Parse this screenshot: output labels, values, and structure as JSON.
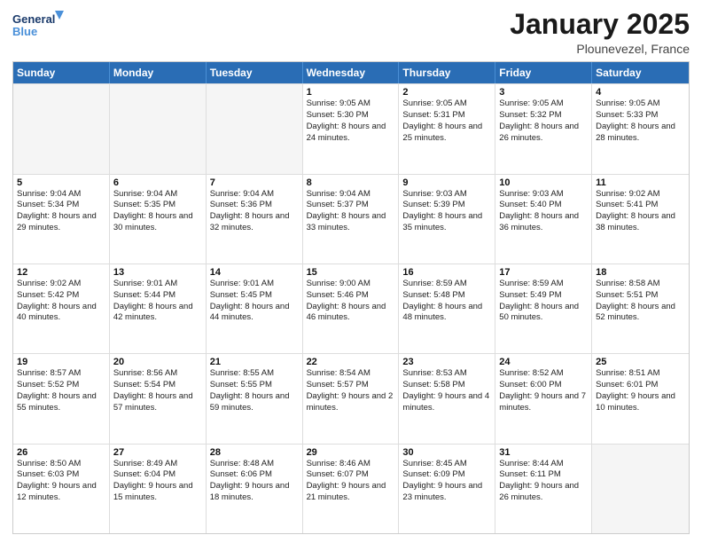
{
  "header": {
    "logo_line1": "General",
    "logo_line2": "Blue",
    "month_title": "January 2025",
    "location": "Plounevezel, France"
  },
  "weekdays": [
    "Sunday",
    "Monday",
    "Tuesday",
    "Wednesday",
    "Thursday",
    "Friday",
    "Saturday"
  ],
  "weeks": [
    [
      {
        "day": "",
        "sunrise": "",
        "sunset": "",
        "daylight": "",
        "empty": true
      },
      {
        "day": "",
        "sunrise": "",
        "sunset": "",
        "daylight": "",
        "empty": true
      },
      {
        "day": "",
        "sunrise": "",
        "sunset": "",
        "daylight": "",
        "empty": true
      },
      {
        "day": "1",
        "sunrise": "Sunrise: 9:05 AM",
        "sunset": "Sunset: 5:30 PM",
        "daylight": "Daylight: 8 hours and 24 minutes."
      },
      {
        "day": "2",
        "sunrise": "Sunrise: 9:05 AM",
        "sunset": "Sunset: 5:31 PM",
        "daylight": "Daylight: 8 hours and 25 minutes."
      },
      {
        "day": "3",
        "sunrise": "Sunrise: 9:05 AM",
        "sunset": "Sunset: 5:32 PM",
        "daylight": "Daylight: 8 hours and 26 minutes."
      },
      {
        "day": "4",
        "sunrise": "Sunrise: 9:05 AM",
        "sunset": "Sunset: 5:33 PM",
        "daylight": "Daylight: 8 hours and 28 minutes."
      }
    ],
    [
      {
        "day": "5",
        "sunrise": "Sunrise: 9:04 AM",
        "sunset": "Sunset: 5:34 PM",
        "daylight": "Daylight: 8 hours and 29 minutes."
      },
      {
        "day": "6",
        "sunrise": "Sunrise: 9:04 AM",
        "sunset": "Sunset: 5:35 PM",
        "daylight": "Daylight: 8 hours and 30 minutes."
      },
      {
        "day": "7",
        "sunrise": "Sunrise: 9:04 AM",
        "sunset": "Sunset: 5:36 PM",
        "daylight": "Daylight: 8 hours and 32 minutes."
      },
      {
        "day": "8",
        "sunrise": "Sunrise: 9:04 AM",
        "sunset": "Sunset: 5:37 PM",
        "daylight": "Daylight: 8 hours and 33 minutes."
      },
      {
        "day": "9",
        "sunrise": "Sunrise: 9:03 AM",
        "sunset": "Sunset: 5:39 PM",
        "daylight": "Daylight: 8 hours and 35 minutes."
      },
      {
        "day": "10",
        "sunrise": "Sunrise: 9:03 AM",
        "sunset": "Sunset: 5:40 PM",
        "daylight": "Daylight: 8 hours and 36 minutes."
      },
      {
        "day": "11",
        "sunrise": "Sunrise: 9:02 AM",
        "sunset": "Sunset: 5:41 PM",
        "daylight": "Daylight: 8 hours and 38 minutes."
      }
    ],
    [
      {
        "day": "12",
        "sunrise": "Sunrise: 9:02 AM",
        "sunset": "Sunset: 5:42 PM",
        "daylight": "Daylight: 8 hours and 40 minutes."
      },
      {
        "day": "13",
        "sunrise": "Sunrise: 9:01 AM",
        "sunset": "Sunset: 5:44 PM",
        "daylight": "Daylight: 8 hours and 42 minutes."
      },
      {
        "day": "14",
        "sunrise": "Sunrise: 9:01 AM",
        "sunset": "Sunset: 5:45 PM",
        "daylight": "Daylight: 8 hours and 44 minutes."
      },
      {
        "day": "15",
        "sunrise": "Sunrise: 9:00 AM",
        "sunset": "Sunset: 5:46 PM",
        "daylight": "Daylight: 8 hours and 46 minutes."
      },
      {
        "day": "16",
        "sunrise": "Sunrise: 8:59 AM",
        "sunset": "Sunset: 5:48 PM",
        "daylight": "Daylight: 8 hours and 48 minutes."
      },
      {
        "day": "17",
        "sunrise": "Sunrise: 8:59 AM",
        "sunset": "Sunset: 5:49 PM",
        "daylight": "Daylight: 8 hours and 50 minutes."
      },
      {
        "day": "18",
        "sunrise": "Sunrise: 8:58 AM",
        "sunset": "Sunset: 5:51 PM",
        "daylight": "Daylight: 8 hours and 52 minutes."
      }
    ],
    [
      {
        "day": "19",
        "sunrise": "Sunrise: 8:57 AM",
        "sunset": "Sunset: 5:52 PM",
        "daylight": "Daylight: 8 hours and 55 minutes."
      },
      {
        "day": "20",
        "sunrise": "Sunrise: 8:56 AM",
        "sunset": "Sunset: 5:54 PM",
        "daylight": "Daylight: 8 hours and 57 minutes."
      },
      {
        "day": "21",
        "sunrise": "Sunrise: 8:55 AM",
        "sunset": "Sunset: 5:55 PM",
        "daylight": "Daylight: 8 hours and 59 minutes."
      },
      {
        "day": "22",
        "sunrise": "Sunrise: 8:54 AM",
        "sunset": "Sunset: 5:57 PM",
        "daylight": "Daylight: 9 hours and 2 minutes."
      },
      {
        "day": "23",
        "sunrise": "Sunrise: 8:53 AM",
        "sunset": "Sunset: 5:58 PM",
        "daylight": "Daylight: 9 hours and 4 minutes."
      },
      {
        "day": "24",
        "sunrise": "Sunrise: 8:52 AM",
        "sunset": "Sunset: 6:00 PM",
        "daylight": "Daylight: 9 hours and 7 minutes."
      },
      {
        "day": "25",
        "sunrise": "Sunrise: 8:51 AM",
        "sunset": "Sunset: 6:01 PM",
        "daylight": "Daylight: 9 hours and 10 minutes."
      }
    ],
    [
      {
        "day": "26",
        "sunrise": "Sunrise: 8:50 AM",
        "sunset": "Sunset: 6:03 PM",
        "daylight": "Daylight: 9 hours and 12 minutes."
      },
      {
        "day": "27",
        "sunrise": "Sunrise: 8:49 AM",
        "sunset": "Sunset: 6:04 PM",
        "daylight": "Daylight: 9 hours and 15 minutes."
      },
      {
        "day": "28",
        "sunrise": "Sunrise: 8:48 AM",
        "sunset": "Sunset: 6:06 PM",
        "daylight": "Daylight: 9 hours and 18 minutes."
      },
      {
        "day": "29",
        "sunrise": "Sunrise: 8:46 AM",
        "sunset": "Sunset: 6:07 PM",
        "daylight": "Daylight: 9 hours and 21 minutes."
      },
      {
        "day": "30",
        "sunrise": "Sunrise: 8:45 AM",
        "sunset": "Sunset: 6:09 PM",
        "daylight": "Daylight: 9 hours and 23 minutes."
      },
      {
        "day": "31",
        "sunrise": "Sunrise: 8:44 AM",
        "sunset": "Sunset: 6:11 PM",
        "daylight": "Daylight: 9 hours and 26 minutes."
      },
      {
        "day": "",
        "sunrise": "",
        "sunset": "",
        "daylight": "",
        "empty": true
      }
    ]
  ]
}
